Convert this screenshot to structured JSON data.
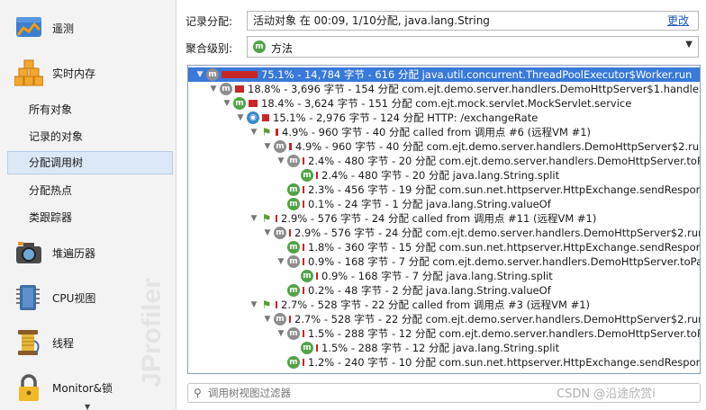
{
  "sidebar": {
    "top_items": [
      {
        "label": "遥测",
        "icon": "telemetry-icon"
      },
      {
        "label": "实时内存",
        "icon": "live-memory-icon"
      }
    ],
    "sub_items": [
      {
        "label": "所有对象",
        "selected": false
      },
      {
        "label": "记录的对象",
        "selected": false
      },
      {
        "label": "分配调用树",
        "selected": true
      },
      {
        "label": "分配热点",
        "selected": false
      },
      {
        "label": "类跟踪器",
        "selected": false
      }
    ],
    "bottom_items": [
      {
        "label": "堆遍历器",
        "icon": "camera-icon"
      },
      {
        "label": "CPU视图",
        "icon": "cpu-icon"
      },
      {
        "label": "线程",
        "icon": "threads-icon"
      },
      {
        "label": "Monitor&锁",
        "icon": "lock-icon"
      }
    ],
    "watermark": "JProfiler"
  },
  "record": {
    "label": "记录分配:",
    "value": "活动对象 在 00:09, 1/10分配, java.lang.String",
    "link": "更改"
  },
  "aggregation": {
    "label": "聚合级别:",
    "value": "方法"
  },
  "tree": {
    "rows": [
      {
        "level": 0,
        "twisty": "▼",
        "icon": "mg",
        "bar": 2.0,
        "text": "75.1% - 14,784 字节 - 616 分配 java.util.concurrent.ThreadPoolExecutor$Worker.run",
        "selected": true
      },
      {
        "level": 1,
        "twisty": "▼",
        "icon": "mg",
        "bar": 0.5,
        "text": "18.8% - 3,696 字节 - 154 分配 com.ejt.demo.server.handlers.DemoHttpServer$1.handle"
      },
      {
        "level": 2,
        "twisty": "▼",
        "icon": "m",
        "bar": 0.5,
        "text": "18.4% - 3,624 字节 - 151 分配 com.ejt.mock.servlet.MockServlet.service"
      },
      {
        "level": 3,
        "twisty": "▼",
        "icon": "g",
        "bar": 0.4,
        "text": "15.1% - 2,976 字节 - 124 分配 HTTP: /exchangeRate"
      },
      {
        "level": 4,
        "twisty": "▼",
        "icon": "f",
        "bar": 0.15,
        "text": "4.9% - 960 字节 - 40 分配 called from 调用点 #6 (远程VM #1)"
      },
      {
        "level": 5,
        "twisty": "▼",
        "icon": "mg",
        "bar": 0.15,
        "text": "4.9% - 960 字节 - 40 分配 com.ejt.demo.server.handlers.DemoHttpServer$2.run"
      },
      {
        "level": 6,
        "twisty": "▼",
        "icon": "mg",
        "bar": 0.08,
        "text": "2.4% - 480 字节 - 20 分配 com.ejt.demo.server.handlers.DemoHttpServer.toPa"
      },
      {
        "level": 7,
        "twisty": "",
        "icon": "m",
        "bar": 0.08,
        "text": "2.4% - 480 字节 - 20 分配 java.lang.String.split"
      },
      {
        "level": 6,
        "twisty": "",
        "icon": "m",
        "bar": 0.07,
        "text": "2.3% - 456 字节 - 19 分配 com.sun.net.httpserver.HttpExchange.sendRespons"
      },
      {
        "level": 6,
        "twisty": "",
        "icon": "m",
        "bar": 0.0,
        "text": "0.1% - 24 字节 - 1 分配 java.lang.String.valueOf"
      },
      {
        "level": 4,
        "twisty": "▼",
        "icon": "f",
        "bar": 0.1,
        "text": "2.9% - 576 字节 - 24 分配 called from 调用点 #11 (远程VM #1)"
      },
      {
        "level": 5,
        "twisty": "▼",
        "icon": "mg",
        "bar": 0.1,
        "text": "2.9% - 576 字节 - 24 分配 com.ejt.demo.server.handlers.DemoHttpServer$2.run"
      },
      {
        "level": 6,
        "twisty": "",
        "icon": "m",
        "bar": 0.06,
        "text": "1.8% - 360 字节 - 15 分配 com.sun.net.httpserver.HttpExchange.sendRespons"
      },
      {
        "level": 6,
        "twisty": "▼",
        "icon": "mg",
        "bar": 0.03,
        "text": "0.9% - 168 字节 - 7 分配 com.ejt.demo.server.handlers.DemoHttpServer.toParame"
      },
      {
        "level": 7,
        "twisty": "",
        "icon": "m",
        "bar": 0.03,
        "text": "0.9% - 168 字节 - 7 分配 java.lang.String.split"
      },
      {
        "level": 6,
        "twisty": "",
        "icon": "m",
        "bar": 0.0,
        "text": "0.2% - 48 字节 - 2 分配 java.lang.String.valueOf"
      },
      {
        "level": 4,
        "twisty": "▼",
        "icon": "f",
        "bar": 0.09,
        "text": "2.7% - 528 字节 - 22 分配 called from 调用点 #3 (远程VM #1)"
      },
      {
        "level": 5,
        "twisty": "▼",
        "icon": "mg",
        "bar": 0.09,
        "text": "2.7% - 528 字节 - 22 分配 com.ejt.demo.server.handlers.DemoHttpServer$2.run"
      },
      {
        "level": 6,
        "twisty": "▼",
        "icon": "mg",
        "bar": 0.05,
        "text": "1.5% - 288 字节 - 12 分配 com.ejt.demo.server.handlers.DemoHttpServer.toPa"
      },
      {
        "level": 7,
        "twisty": "",
        "icon": "m",
        "bar": 0.05,
        "text": "1.5% - 288 字节 - 12 分配 java.lang.String.split"
      },
      {
        "level": 6,
        "twisty": "",
        "icon": "m",
        "bar": 0.04,
        "text": "1.2% - 240 字节 - 10 分配 com.sun.net.httpserver.HttpExchange.sendRespons"
      }
    ]
  },
  "filter": {
    "placeholder": "调用树视图过滤器"
  },
  "credit": "CSDN @沿途欣赏i"
}
